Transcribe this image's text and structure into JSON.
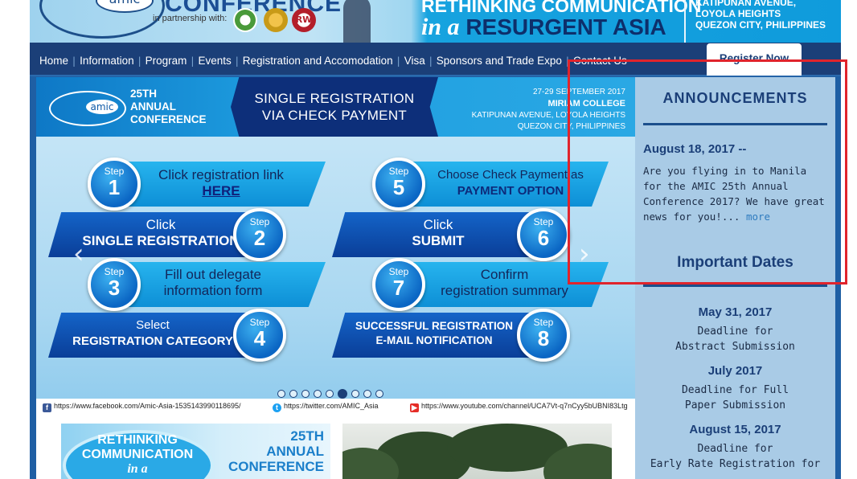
{
  "header": {
    "conference_word": "CONFERENCE",
    "amic": "amic",
    "partnership": "in partnership with:",
    "partner_rw": "RW",
    "title_line1": "RETHINKING COMMUNICATION",
    "title_in_a": "in a",
    "title_resurgent": "RESURGENT ASIA",
    "venue": [
      "KATIPUNAN AVENUE,",
      "LOYOLA HEIGHTS",
      "QUEZON CITY, PHILIPPINES"
    ]
  },
  "nav": {
    "items": [
      "Home",
      "Information",
      "Program",
      "Events",
      "Registration and Accomodation",
      "Visa",
      "Sponsors and Trade Expo",
      "Contact Us"
    ],
    "register": "Register Now"
  },
  "slider": {
    "top": {
      "amic": "amic",
      "conf_lines": [
        "25TH",
        "ANNUAL",
        "CONFERENCE"
      ],
      "center_lines": [
        "SINGLE REGISTRATION",
        "VIA CHECK PAYMENT"
      ],
      "date": "27-29 SEPTEMBER 2017",
      "venue_name": "MIRIAM COLLEGE",
      "venue_lines": [
        "KATIPUNAN AVENUE, LOYOLA HEIGHTS",
        "QUEZON CITY, PHILIPPINES"
      ]
    },
    "step_word": "Step",
    "steps": [
      {
        "n": "1",
        "line1": "Click registration link",
        "line2": "HERE"
      },
      {
        "n": "2",
        "line1": "Click",
        "line2": "SINGLE REGISTRATION"
      },
      {
        "n": "3",
        "line1": "Fill out delegate",
        "line2": "information form"
      },
      {
        "n": "4",
        "line1": "Select",
        "line2": "REGISTRATION CATEGORY"
      },
      {
        "n": "5",
        "line1": "Choose Check Payment as",
        "line2": "PAYMENT OPTION"
      },
      {
        "n": "6",
        "line1": "Click",
        "line2": "SUBMIT"
      },
      {
        "n": "7",
        "line1": "Confirm",
        "line2": "registration summary"
      },
      {
        "n": "8",
        "line1": "SUCCESSFUL REGISTRATION",
        "line2": "E-MAIL NOTIFICATION"
      }
    ],
    "prev_arrow": "‹",
    "next_arrow": "›",
    "dots_count": 9,
    "active_dot": 6,
    "social": {
      "facebook": "https://www.facebook.com/Amic-Asia-1535143990118695/",
      "twitter": "https://twitter.com/AMIC_Asia",
      "youtube": "https://www.youtube.com/channel/UCA7Vt-q7nCyy5bUBNI83Ltg"
    }
  },
  "sidebar": {
    "announcements_title": "ANNOUNCEMENTS",
    "announcement_date": "August 18, 2017 --",
    "announcement_body": "Are you flying in to Manila for the AMIC 25th Annual Conference 2017? We have great news for you!...",
    "more": "more",
    "important_title": "Important Dates",
    "dates": [
      {
        "date": "May 31, 2017",
        "desc1": "Deadline for",
        "desc2": "Abstract Submission"
      },
      {
        "date": "July 2017",
        "desc1": "Deadline for Full",
        "desc2": "Paper Submission"
      },
      {
        "date": "August 15, 2017",
        "desc1": "Deadline for",
        "desc2": "Early Rate Registration for"
      }
    ]
  },
  "thumbs": {
    "t1_lines": [
      "RETHINKING",
      "COMMUNICATION",
      "in a"
    ],
    "t1_conf": [
      "25TH",
      "ANNUAL",
      "CONFERENCE"
    ]
  },
  "colors": {
    "nav_bg": "#1b3f78",
    "sidebar_bg": "#a9cbe6",
    "highlight": "#e0242c",
    "accent": "#0e78c6"
  }
}
